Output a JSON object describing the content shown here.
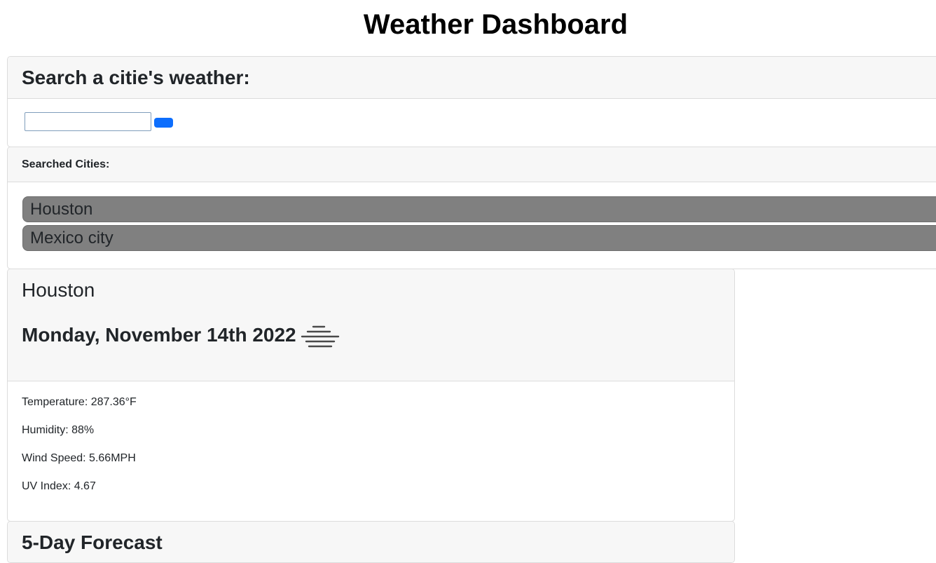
{
  "page": {
    "title": "Weather Dashboard"
  },
  "search": {
    "title": "Search a citie's weather:",
    "input_value": "",
    "input_placeholder": "",
    "button_label": "",
    "button_color": "#0d6efd"
  },
  "history": {
    "title": "Searched Cities:",
    "items": [
      {
        "label": "Houston"
      },
      {
        "label": "Mexico city"
      }
    ],
    "item_color": "#808080"
  },
  "current": {
    "city": "Houston",
    "date": "Monday, November 14th 2022",
    "icon": "mist-icon",
    "temperature": "Temperature: 287.36°F",
    "humidity": "Humidity: 88%",
    "wind": "Wind Speed: 5.66MPH",
    "uv": "UV Index: 4.67"
  },
  "forecast": {
    "title": "5-Day Forecast"
  }
}
